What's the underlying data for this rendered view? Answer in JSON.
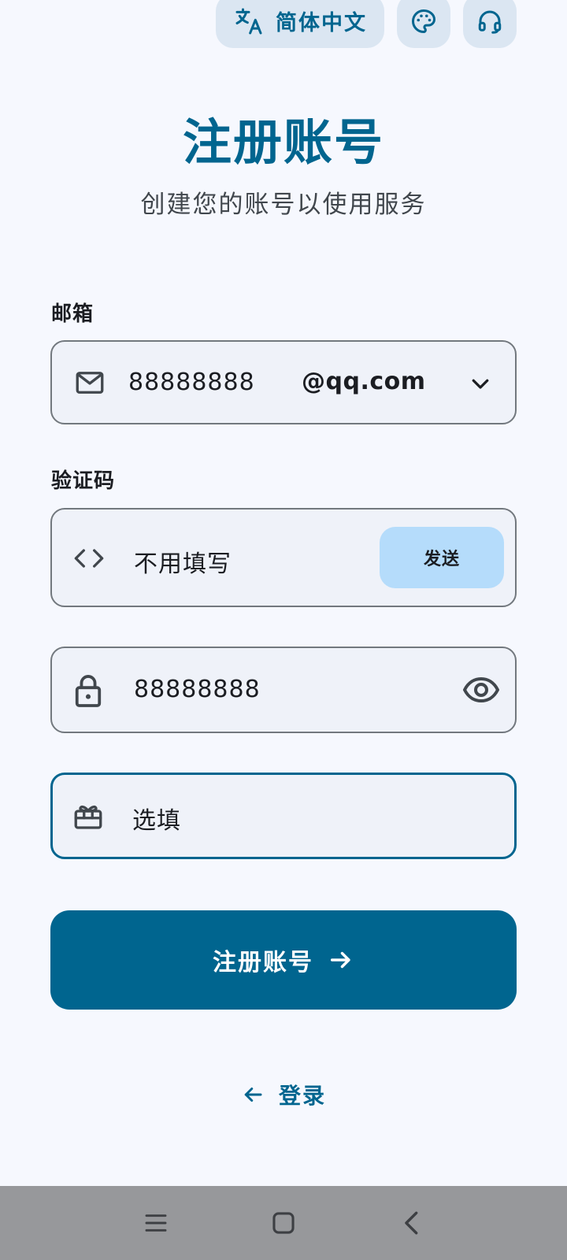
{
  "header": {
    "language_label": "简体中文",
    "language_icon": "translate-icon",
    "theme_icon": "palette-icon",
    "support_icon": "headset-icon"
  },
  "page": {
    "title": "注册账号",
    "subtitle": "创建您的账号以使用服务"
  },
  "form": {
    "email": {
      "label": "邮箱",
      "value": "88888888",
      "domain": "@qq.com",
      "icon": "mail-icon"
    },
    "code": {
      "label": "验证码",
      "value": "不用填写",
      "send_label": "发送",
      "icon": "code-icon"
    },
    "password": {
      "value": "88888888",
      "icon": "lock-icon"
    },
    "invite": {
      "placeholder": "选填",
      "icon": "gift-card-icon"
    }
  },
  "actions": {
    "register_label": "注册账号",
    "login_label": "登录"
  },
  "colors": {
    "primary": "#00658f",
    "background": "#f6f8fe",
    "field_bg": "#eff2f9",
    "send_bg": "#b5dcfb",
    "navbar": "#97989b"
  }
}
